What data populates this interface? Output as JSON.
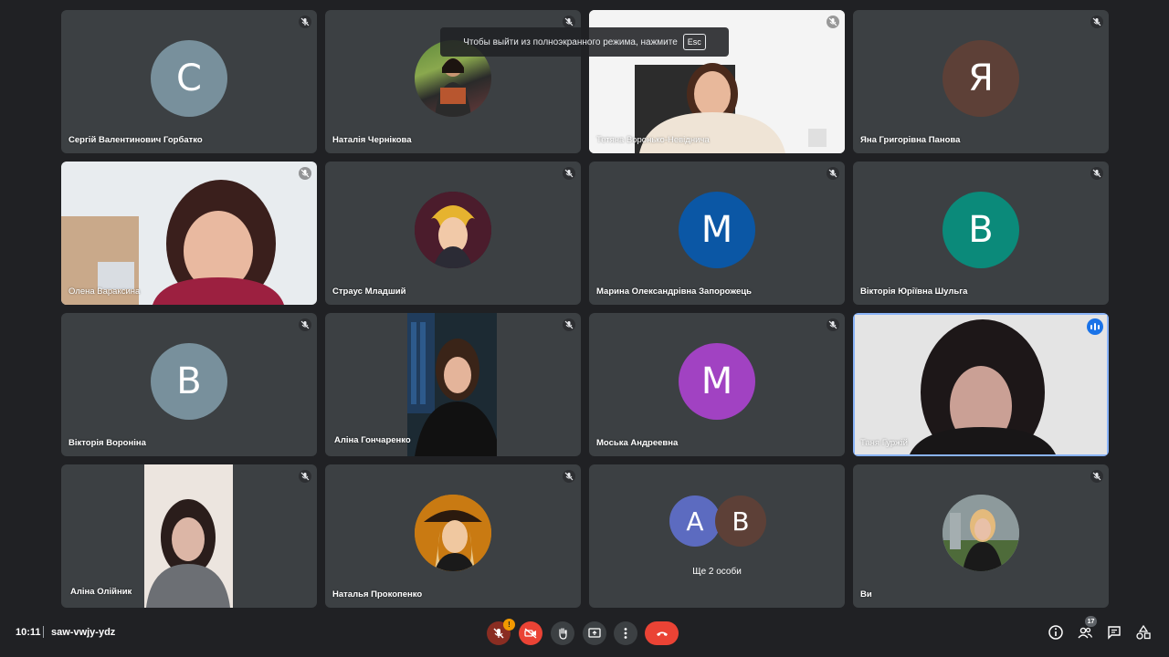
{
  "tooltip": {
    "text": "Чтобы выйти из полноэкранного режима, нажмите",
    "key": "Esc"
  },
  "participants": [
    {
      "name": "Сергій Валентинович Горбатко",
      "initial": "С",
      "avatar_color": "#78909c"
    },
    {
      "name": "Наталія Чернікова"
    },
    {
      "name": "Тетяна Воронько-Невіднича"
    },
    {
      "name": "Яна Григорівна Панова",
      "initial": "Я",
      "avatar_color": "#5d4037"
    },
    {
      "name": "Олена Вараксина"
    },
    {
      "name": "Страус Младший"
    },
    {
      "name": "Марина Олександрівна Запорожець",
      "initial": "М",
      "avatar_color": "#0b57a5"
    },
    {
      "name": "Вікторія Юріївна Шульга",
      "initial": "В",
      "avatar_color": "#0b8a7a"
    },
    {
      "name": "Вікторія Вороніна",
      "initial": "В",
      "avatar_color": "#78909c"
    },
    {
      "name": "Аліна Гончаренко"
    },
    {
      "name": "Моська Андреевна",
      "initial": "М",
      "avatar_color": "#a142c2"
    },
    {
      "name": "Таня Гуржій"
    },
    {
      "name": "Аліна Олійник"
    },
    {
      "name": "Наталья Прокопенко"
    },
    {
      "name": "Ви"
    }
  ],
  "others": {
    "label": "Ще 2 особи",
    "avatars": [
      {
        "initial": "А",
        "color": "#5c6bc0"
      },
      {
        "initial": "В",
        "color": "#5d4037"
      }
    ]
  },
  "bottom": {
    "time": "10:11",
    "meeting_code": "saw-vwjy-ydz",
    "mic_badge": "!",
    "participants_count": "17"
  },
  "colors": {
    "background": "#202124",
    "tile": "#3c4043",
    "end_call": "#ea4335",
    "muted_button": "#ea4335",
    "speaking_accent": "#1a73e8"
  }
}
